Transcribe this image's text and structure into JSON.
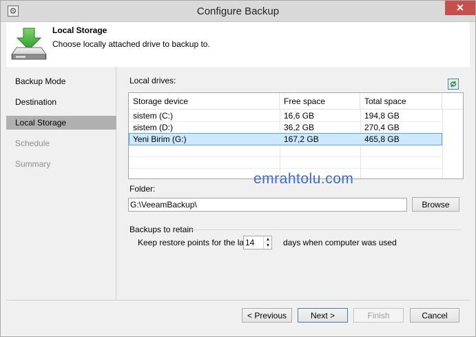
{
  "window": {
    "title": "Configure Backup",
    "close_symbol": "✕"
  },
  "header": {
    "title": "Local Storage",
    "subtitle": "Choose locally attached drive to backup to.",
    "icon": "drive-download-icon"
  },
  "nav": {
    "items": [
      {
        "label": "Backup Mode",
        "state": "normal"
      },
      {
        "label": "Destination",
        "state": "normal"
      },
      {
        "label": "Local Storage",
        "state": "selected"
      },
      {
        "label": "Schedule",
        "state": "disabled"
      },
      {
        "label": "Summary",
        "state": "disabled"
      }
    ]
  },
  "main": {
    "local_drives_label": "Local drives:",
    "table": {
      "headers": [
        "Storage device",
        "Free space",
        "Total space"
      ],
      "rows": [
        {
          "device": "sistem (C:)",
          "free": "16,6 GB",
          "total": "194,8 GB",
          "selected": false
        },
        {
          "device": "sistem (D:)",
          "free": "36,2 GB",
          "total": "270,4 GB",
          "selected": false
        },
        {
          "device": "Yeni Birim (G:)",
          "free": "167,2 GB",
          "total": "465,8 GB",
          "selected": true
        }
      ]
    },
    "folder_label": "Folder:",
    "folder_value": "G:\\VeeamBackup\\",
    "browse_label": "Browse",
    "retain_label": "Backups to retain",
    "keep_prefix": "Keep restore points for the last",
    "keep_value": "14",
    "keep_suffix": "days when computer was used",
    "watermark": "emrahtolu.com"
  },
  "footer": {
    "previous": "< Previous",
    "next": "Next >",
    "finish": "Finish",
    "cancel": "Cancel"
  },
  "colors": {
    "selection_fill": "#cce8ff",
    "selection_border": "#5ea6d9",
    "close_button": "#c7504c",
    "nav_selected": "#b0b0b0"
  }
}
